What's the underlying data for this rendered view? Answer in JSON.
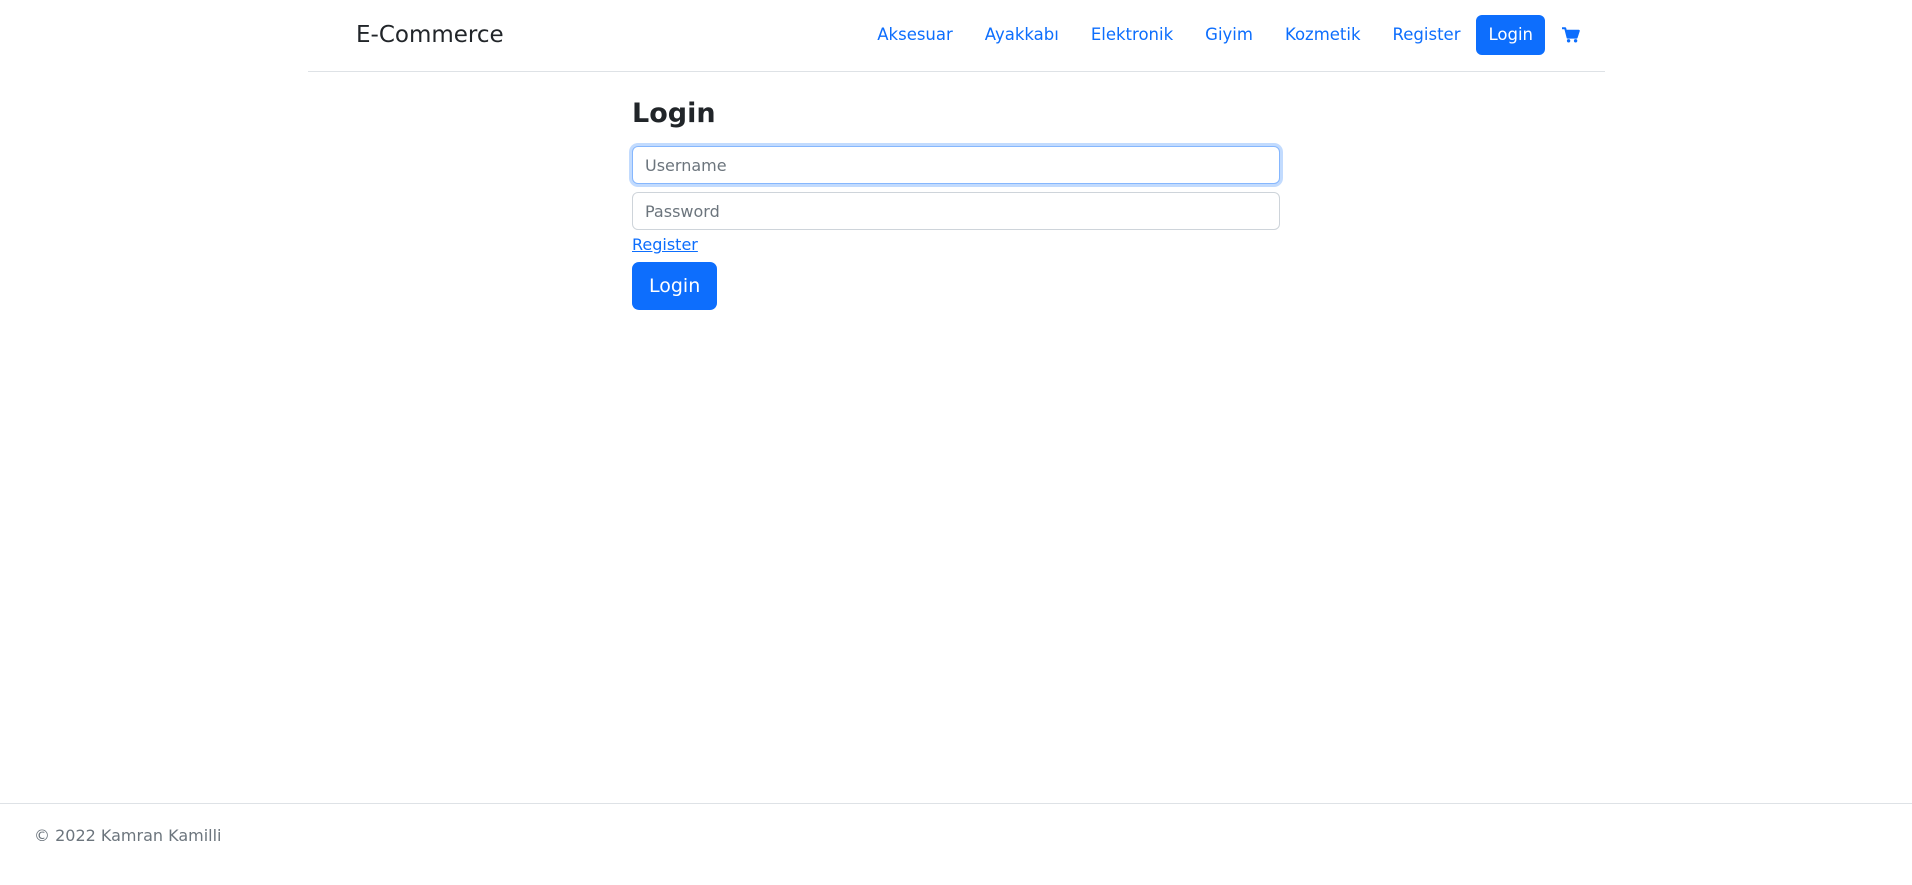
{
  "navbar": {
    "brand": "E-Commerce",
    "links": [
      {
        "label": "Aksesuar"
      },
      {
        "label": "Ayakkabı"
      },
      {
        "label": "Elektronik"
      },
      {
        "label": "Giyim"
      },
      {
        "label": "Kozmetik"
      },
      {
        "label": "Register"
      }
    ],
    "login_button": "Login",
    "cart_icon": "shopping-cart-icon"
  },
  "login_form": {
    "title": "Login",
    "username_placeholder": "Username",
    "username_value": "",
    "password_placeholder": "Password",
    "password_value": "",
    "register_link": "Register",
    "submit_label": "Login"
  },
  "footer": {
    "copyright": "© 2022 Kamran Kamilli"
  },
  "colors": {
    "primary": "#0d6efd",
    "text": "#212529",
    "muted": "#6c757d",
    "border": "#dee2e6"
  }
}
